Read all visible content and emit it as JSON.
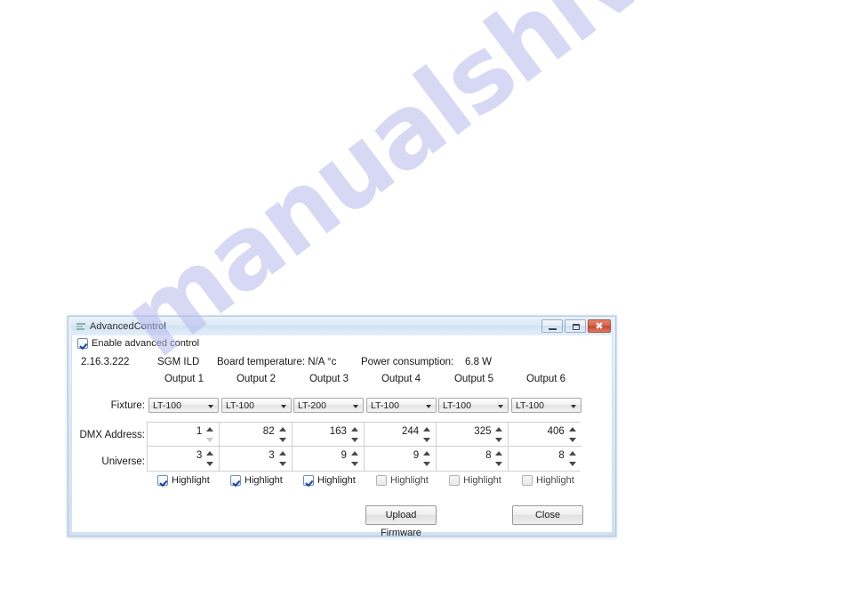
{
  "watermark": {
    "text": "manualshive.com",
    "color": "#b6b9ec"
  },
  "window": {
    "title": "AdvancedControl",
    "icon": "document-lines-icon",
    "controls": {
      "minimize_label": "",
      "maximize_label": "",
      "close_label": "✖"
    }
  },
  "enable": {
    "label": "Enable advanced control",
    "checked": true
  },
  "info": {
    "ip": "2.16.3.222",
    "brand": "SGM ILD",
    "temperature": "Board temperature: N/A °c",
    "power_label": "Power consumption:",
    "power_value": "6.8 W"
  },
  "columns": {
    "headers": [
      "Output 1",
      "Output 2",
      "Output 3",
      "Output 4",
      "Output 5",
      "Output 6"
    ]
  },
  "rows": {
    "fixture_label": "Fixture:",
    "dmx_label": "DMX Address:",
    "universe_label": "Universe:",
    "highlight_label": "Highlight"
  },
  "fixtures": [
    "LT-100",
    "LT-100",
    "LT-200",
    "LT-100",
    "LT-100",
    "LT-100"
  ],
  "dmx_addresses": [
    "1",
    "82",
    "163",
    "244",
    "325",
    "406"
  ],
  "universes": [
    "3",
    "3",
    "9",
    "9",
    "8",
    "8"
  ],
  "highlights": [
    true,
    true,
    true,
    false,
    false,
    false
  ],
  "buttons": {
    "upload_firmware": "Upload Firmware",
    "close": "Close"
  }
}
